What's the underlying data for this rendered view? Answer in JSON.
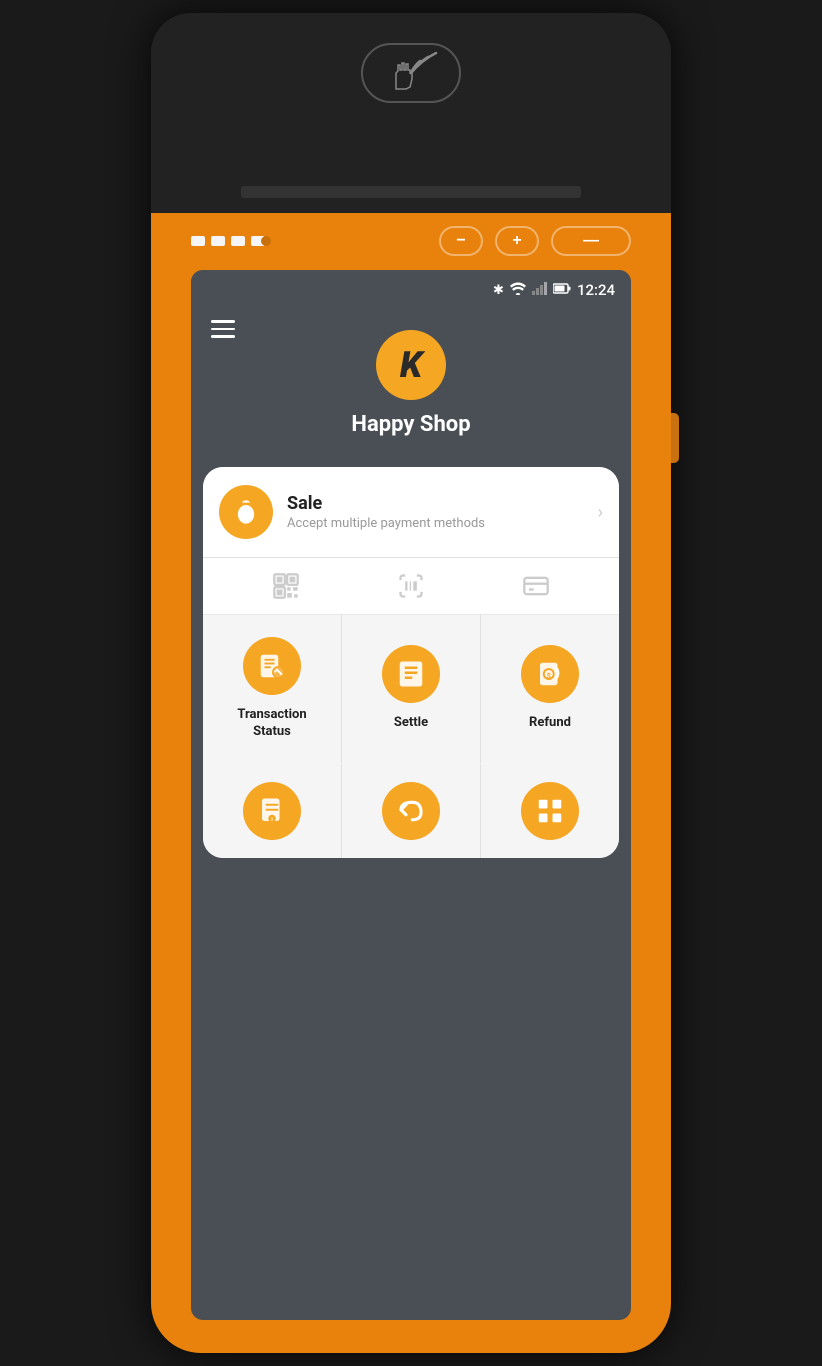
{
  "device": {
    "status_bar": {
      "time": "12:24"
    },
    "app": {
      "shop_name": "Happy Shop",
      "menu_icon_label": "Menu"
    },
    "sale": {
      "title": "Sale",
      "subtitle": "Accept multiple payment methods"
    },
    "grid_items": [
      {
        "id": "transaction-status",
        "label": "Transaction\nStatus",
        "icon": "transaction-status-icon"
      },
      {
        "id": "settle",
        "label": "Settle",
        "icon": "settle-icon"
      },
      {
        "id": "refund",
        "label": "Refund",
        "icon": "refund-icon"
      }
    ],
    "bottom_items": [
      {
        "id": "bottom-1",
        "icon": "menu-icon-1"
      },
      {
        "id": "bottom-2",
        "icon": "menu-icon-2"
      },
      {
        "id": "bottom-3",
        "icon": "menu-icon-3"
      }
    ],
    "buttons": {
      "minus": "−",
      "plus": "+",
      "dash": "—"
    }
  }
}
